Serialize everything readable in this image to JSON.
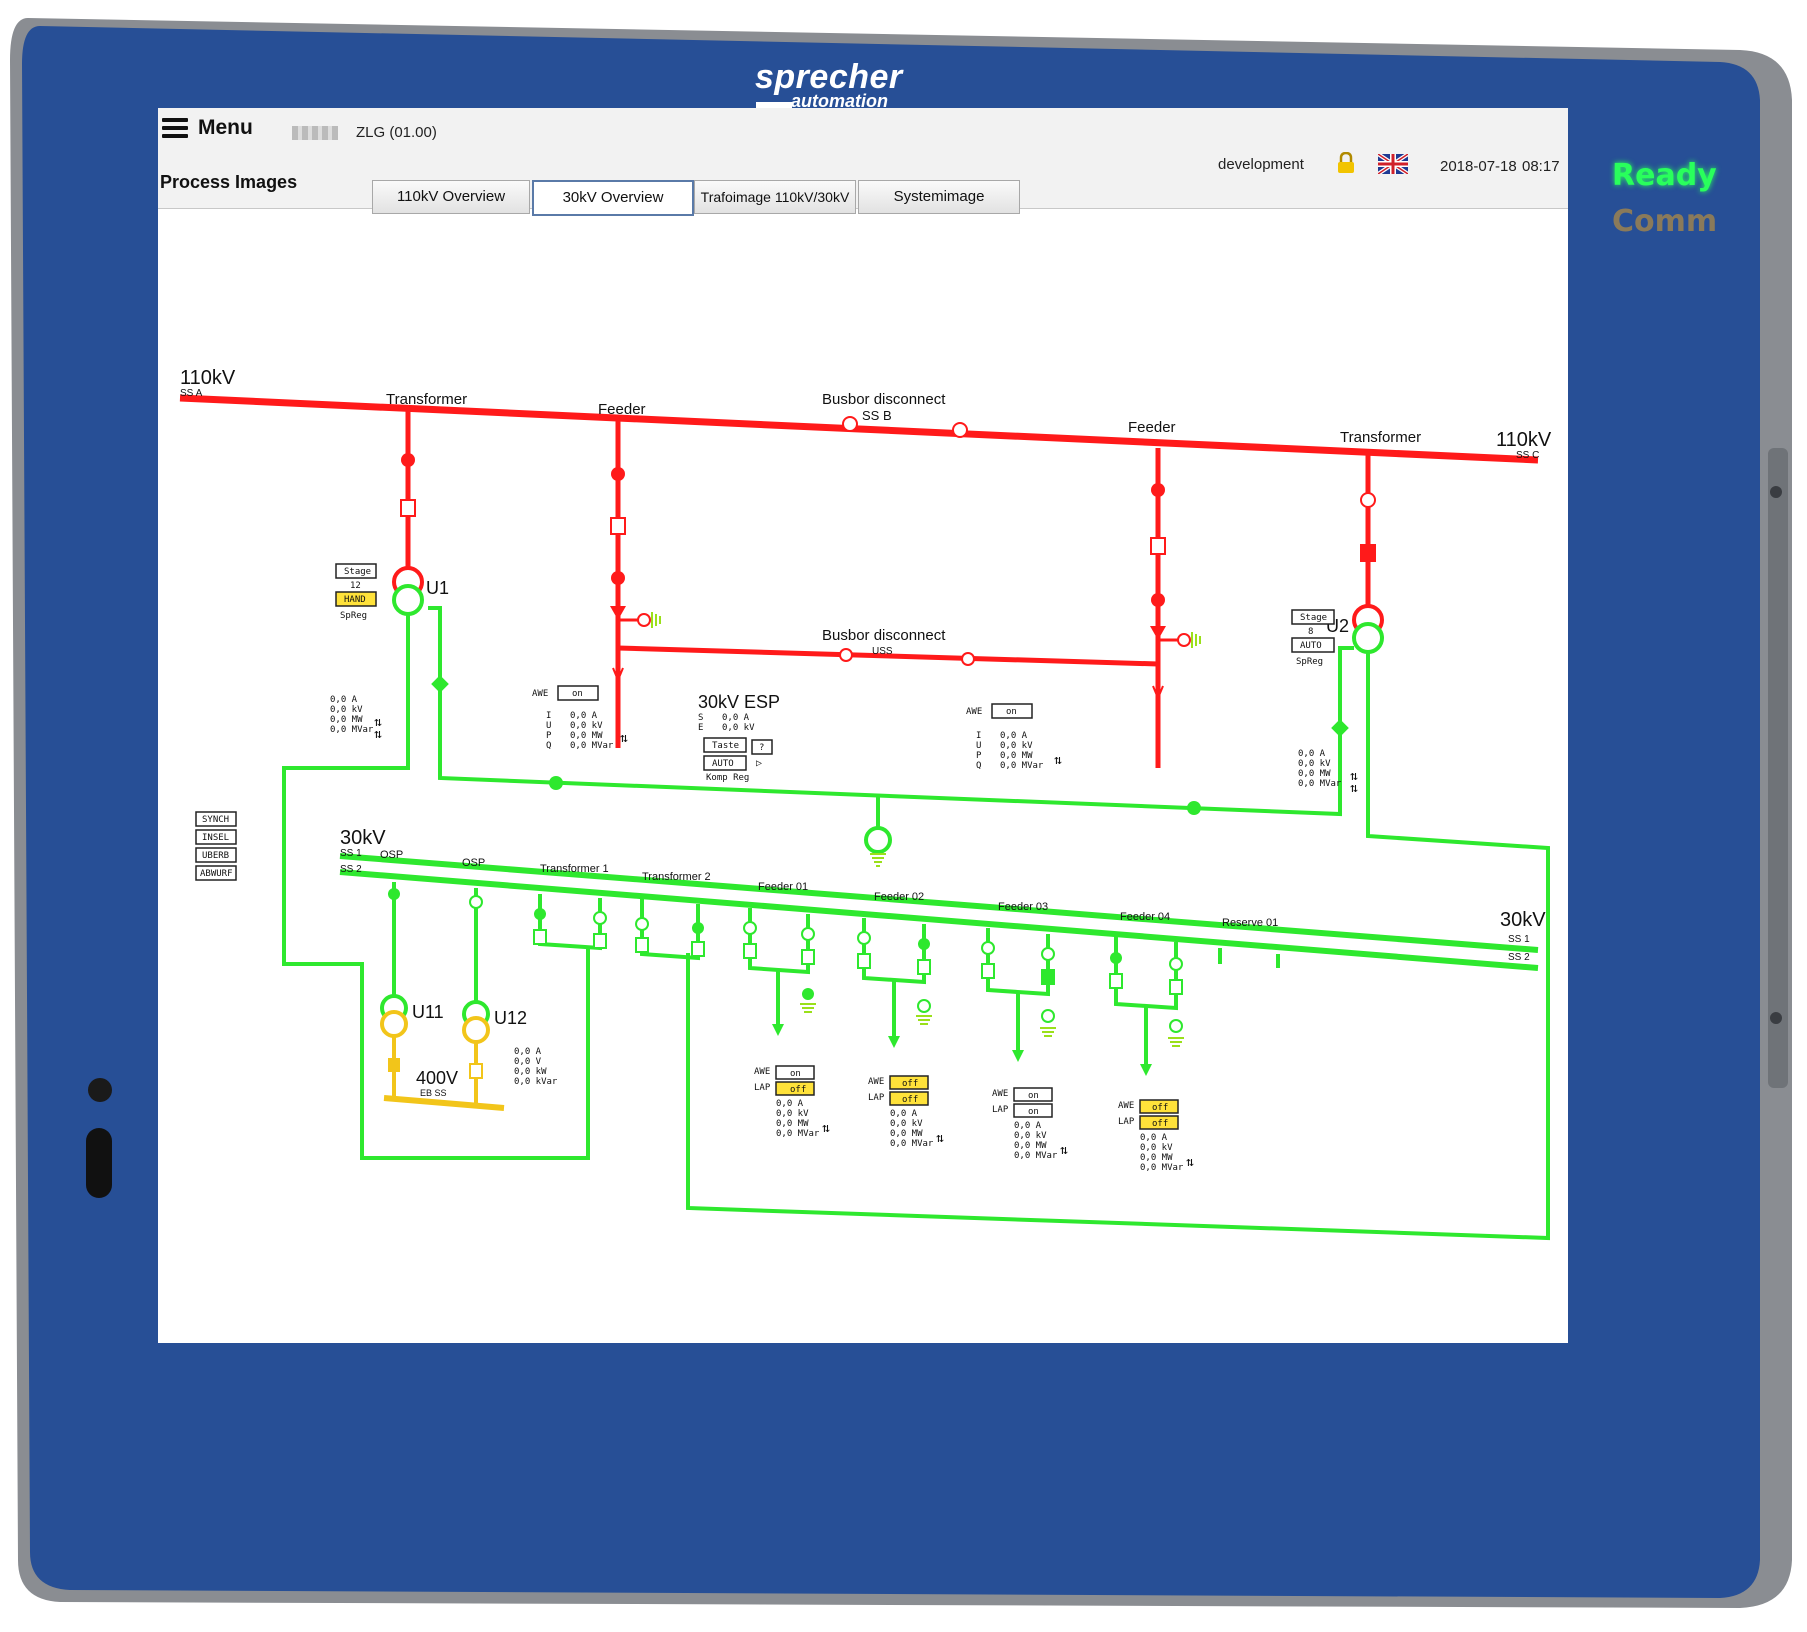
{
  "device": {
    "brand_line1": "sprecher",
    "brand_line2": "automation",
    "led_ready": "Ready",
    "led_comm": "Comm"
  },
  "header": {
    "menu_label": "Menu",
    "station": "ZLG (01.00)",
    "section_title": "Process Images",
    "user": "development",
    "date": "2018-07-18",
    "time": "08:17"
  },
  "tabs": [
    {
      "label": "110kV Overview"
    },
    {
      "label": "30kV Overview"
    },
    {
      "label": "Trafoimage 110kV/30kV"
    },
    {
      "label": "Systemimage"
    }
  ],
  "hv": {
    "left_voltage": "110kV",
    "left_ss": "SS A",
    "right_voltage": "110kV",
    "right_ss": "SS C",
    "transformer_left": "Transformer",
    "feeder_left": "Feeder",
    "busbar_top": "Busbor disconnect",
    "busbar_top_sub": "SS B",
    "feeder_right": "Feeder",
    "transformer_right": "Transformer",
    "busbar_bottom": "Busbor disconnect",
    "busbar_bottom_sub": "USS"
  },
  "u1": {
    "name": "U1",
    "stage_label": "Stage",
    "stage_value": "12",
    "mode": "HAND",
    "reg": "SpReg",
    "values": [
      "0,0 A",
      "0,0 kV",
      "0,0 MW",
      "0,0 MVar"
    ]
  },
  "u2": {
    "name": "U2",
    "stage_label": "Stage",
    "stage_value": "8",
    "mode": "AUTO",
    "reg": "SpReg",
    "values": [
      "0,0 A",
      "0,0 kV",
      "0,0 MW",
      "0,0 MVar"
    ]
  },
  "feeder_left_meas": {
    "awe_label": "AWE",
    "awe_state": "on",
    "letters": [
      "I",
      "U",
      "P",
      "Q"
    ],
    "values": [
      "0,0 A",
      "0,0 kV",
      "0,0 MW",
      "0,0 MVar"
    ]
  },
  "feeder_right_meas": {
    "awe_label": "AWE",
    "awe_state": "on",
    "letters": [
      "I",
      "U",
      "P",
      "Q"
    ],
    "values": [
      "0,0 A",
      "0,0 kV",
      "0,0 MW",
      "0,0 MVar"
    ]
  },
  "esp": {
    "title": "30kV ESP",
    "letters": [
      "S",
      "E"
    ],
    "values": [
      "0,0 A",
      "0,0 kV"
    ],
    "taste": "Taste",
    "question": "?",
    "auto": "AUTO",
    "komp": "Komp Reg"
  },
  "side_buttons": [
    "SYNCH",
    "INSEL",
    "UBERB",
    "ABWURF"
  ],
  "mv": {
    "left_voltage": "30kV",
    "left_ss1": "SS 1",
    "left_ss2": "SS 2",
    "right_voltage": "30kV",
    "right_ss1": "SS 1",
    "right_ss2": "SS 2",
    "osp1": "OSP",
    "osp2": "OSP",
    "transformer1": "Transformer 1",
    "transformer2": "Transformer 2",
    "feeder01": "Feeder 01",
    "feeder02": "Feeder 02",
    "feeder03": "Feeder 03",
    "feeder04": "Feeder 04",
    "reserve01": "Reserve 01"
  },
  "lv": {
    "u11": "U11",
    "u12": "U12",
    "voltage": "400V",
    "ss": "EB SS",
    "values": [
      "0,0 A",
      "0,0 V",
      "0,0 kW",
      "0,0 kVar"
    ]
  },
  "feeders": [
    {
      "awe": "on",
      "lap": "off",
      "awe_color": "#ffffff",
      "lap_color": "#ffe23a",
      "values": [
        "0,0 A",
        "0,0 kV",
        "0,0 MW",
        "0,0 MVar"
      ]
    },
    {
      "awe": "off",
      "lap": "off",
      "awe_color": "#ffe23a",
      "lap_color": "#ffe23a",
      "values": [
        "0,0 A",
        "0,0 kV",
        "0,0 MW",
        "0,0 MVar"
      ]
    },
    {
      "awe": "on",
      "lap": "on",
      "awe_color": "#ffffff",
      "lap_color": "#ffffff",
      "values": [
        "0,0 A",
        "0,0 kV",
        "0,0 MW",
        "0,0 MVar"
      ]
    },
    {
      "awe": "off",
      "lap": "off",
      "awe_color": "#ffe23a",
      "lap_color": "#ffe23a",
      "values": [
        "0,0 A",
        "0,0 kV",
        "0,0 MW",
        "0,0 MVar"
      ]
    }
  ],
  "feeder_labels": {
    "awe": "AWE",
    "lap": "LAP"
  },
  "colors": {
    "hv_energized": "#ff1a1a",
    "mv_energized": "#2ee82e",
    "lv_energized": "#f2c51a",
    "bezel": "#274f96",
    "frame": "#8a8d92"
  }
}
